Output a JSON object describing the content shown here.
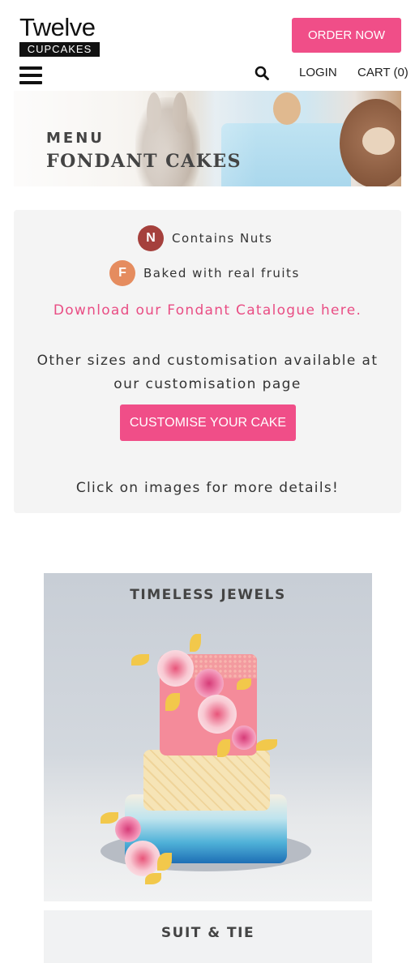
{
  "header": {
    "logo_top": "Twelve",
    "logo_bottom": "CUPCAKES",
    "order_button": "ORDER NOW",
    "login": "LOGIN",
    "cart": "CART (0)"
  },
  "banner": {
    "menu": "MENU",
    "title": "FONDANT CAKES"
  },
  "info": {
    "legend": [
      {
        "letter": "N",
        "text": "Contains Nuts",
        "color": "#a5403c"
      },
      {
        "letter": "F",
        "text": "Baked with real fruits",
        "color": "#e58c5f"
      }
    ],
    "catalogue_link": "Download our Fondant Catalogue here.",
    "custom_text": "Other sizes and customisation available at our customisation page",
    "customise_button": "CUSTOMISE YOUR CAKE",
    "click_hint": "Click on images for more details!"
  },
  "products": [
    {
      "name": "TIMELESS JEWELS"
    },
    {
      "name": "SUIT & TIE"
    }
  ],
  "colors": {
    "accent": "#f04e88",
    "link": "#e94d84",
    "panel": "#f4f4f4"
  }
}
